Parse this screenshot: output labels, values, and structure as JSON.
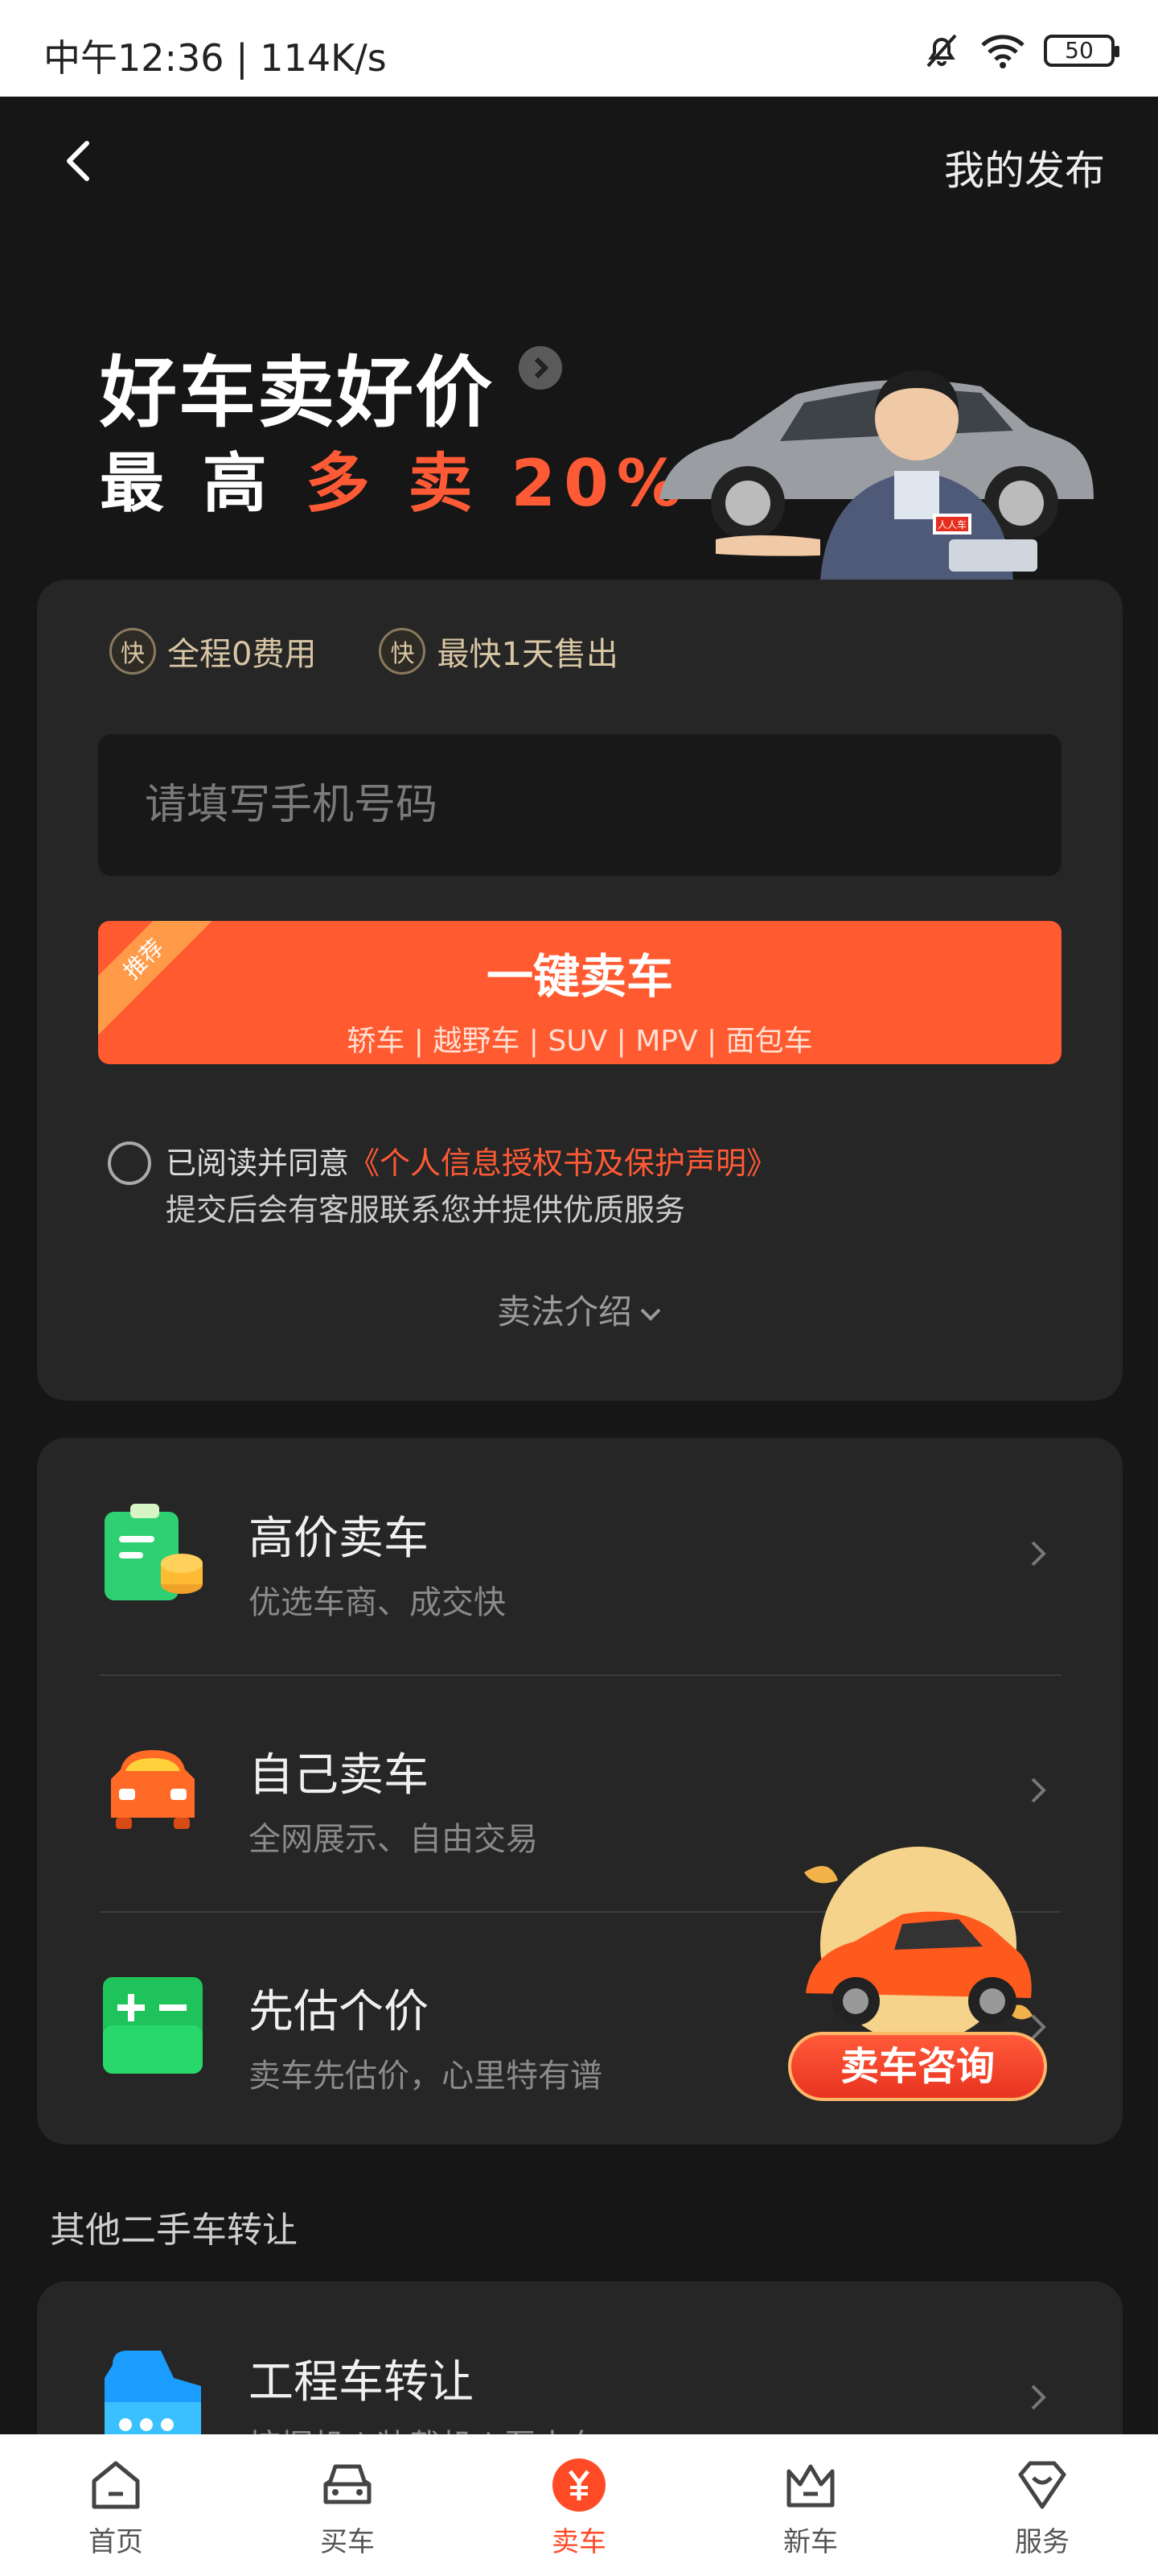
{
  "status_bar": {
    "left": "中午12:36 | 114K/s",
    "battery": "50"
  },
  "header": {
    "right_label": "我的发布"
  },
  "banner": {
    "title": "好车卖好价",
    "sub_prefix": "最 高 ",
    "sub_highlight": "多 卖 20%",
    "badge": "人人车"
  },
  "form": {
    "features": [
      {
        "badge": "快",
        "label": "全程0费用"
      },
      {
        "badge": "快",
        "label": "最快1天售出"
      }
    ],
    "phone_placeholder": "请填写手机号码",
    "sell_button": {
      "label": "一键卖车",
      "types": "轿车 | 越野车 | SUV | MPV | 面包车",
      "ribbon": "推荐"
    },
    "agree_prefix": "已阅读并同意",
    "agree_link": "《个人信息授权书及保护声明》",
    "agree_note": "提交后会有客服联系您并提供优质服务",
    "intro": "卖法介绍"
  },
  "options": [
    {
      "title": "高价卖车",
      "sub": "优选车商、成交快",
      "icon": "clipboard-coins-icon"
    },
    {
      "title": "自己卖车",
      "sub": "全网展示、自由交易",
      "icon": "car-front-icon"
    },
    {
      "title": "先估个价",
      "sub": "卖车先估价，心里特有谱",
      "icon": "calculator-icon"
    }
  ],
  "consult": {
    "label": "卖车咨询"
  },
  "other": {
    "section_title": "其他二手车转让",
    "eng_title": "工程车转让",
    "eng_sub": "挖掘机 | 装载机 | 泵水车"
  },
  "nav": [
    {
      "label": "首页",
      "icon": "home-icon"
    },
    {
      "label": "买车",
      "icon": "car-icon"
    },
    {
      "label": "卖车",
      "icon": "yen-icon"
    },
    {
      "label": "新车",
      "icon": "crown-icon"
    },
    {
      "label": "服务",
      "icon": "heart-service-icon"
    }
  ],
  "colors": {
    "accent": "#ff5a30",
    "bg": "#161616",
    "card": "#262626",
    "gold": "#d9c6a4"
  }
}
